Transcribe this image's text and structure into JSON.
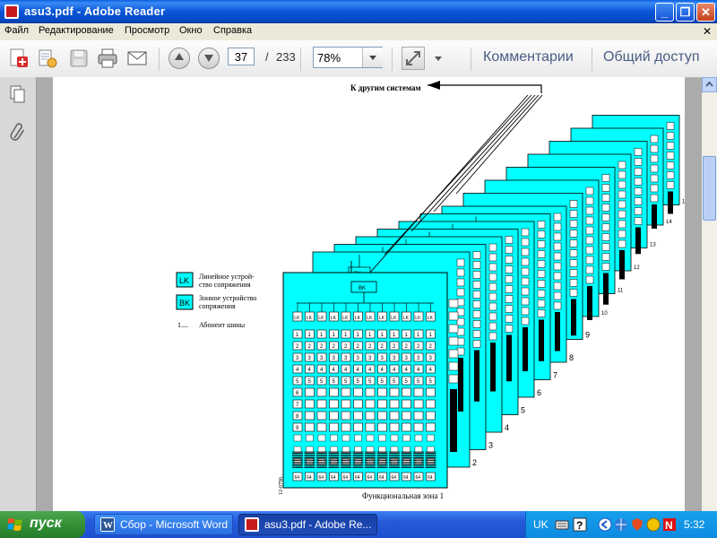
{
  "window": {
    "title": "asu3.pdf - Adobe Reader",
    "minimize_label": "_",
    "maximize_label": "❐",
    "close_label": "✕"
  },
  "menu": {
    "items": [
      "Файл",
      "Редактирование",
      "Просмотр",
      "Окно",
      "Справка"
    ],
    "close_doc": "✕"
  },
  "toolbar": {
    "current_page": "37",
    "page_separator": "/",
    "total_pages": "233",
    "zoom": "78%",
    "comments_label": "Комментарии",
    "share_label": "Общий доступ"
  },
  "diagram": {
    "top_label": "К другим системам",
    "bottom_label": "Функциональная зона 1",
    "figure_code": "12-0796",
    "legend": {
      "lk_code": "LK",
      "lk_desc_1": "Линейное устрой-",
      "lk_desc_2": "ство сопряжения",
      "bk_code": "BK",
      "bk_desc_1": "Зонное устройство",
      "bk_desc_2": "сопряжения",
      "subscriber_code": "1....",
      "subscriber_desc": "Абонент шины"
    },
    "bk_label": "BK",
    "lk_label": "LK",
    "bottom_cell_label": "64",
    "zone_numbers": [
      "2",
      "3",
      "4",
      "5",
      "6",
      "7",
      "8",
      "9",
      "10",
      "11",
      "12",
      "13",
      "14",
      "15"
    ],
    "row_labels": [
      "1",
      "2",
      "3",
      "4",
      "5",
      "6",
      "7",
      "8",
      "9",
      "10",
      "11",
      "12"
    ]
  },
  "taskbar": {
    "start_label": "пуск",
    "tasks": [
      {
        "label": "Сбор - Microsoft Word"
      },
      {
        "label": "asu3.pdf - Adobe Re..."
      }
    ],
    "language": "UK",
    "clock": "5:32"
  },
  "colors": {
    "cyan": "#00ffff",
    "title_blue": "#0a55d8",
    "start_green": "#2f8d32"
  }
}
